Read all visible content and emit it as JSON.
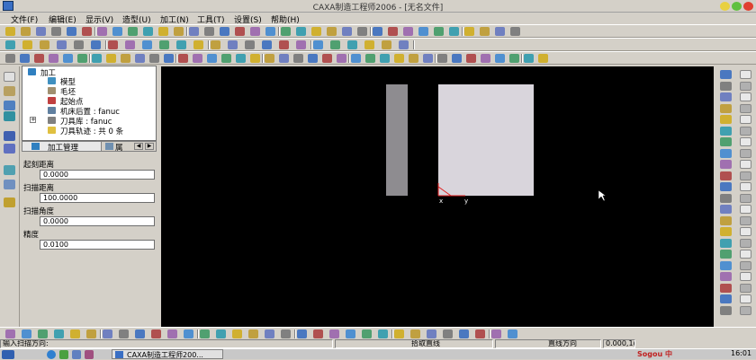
{
  "window": {
    "title": "CAXA制造工程师2006 - [无名文件]"
  },
  "menu": [
    "文件(F)",
    "编辑(E)",
    "显示(V)",
    "造型(U)",
    "加工(N)",
    "工具(T)",
    "设置(S)",
    "帮助(H)"
  ],
  "tree": {
    "root": "加工",
    "items": [
      "模型",
      "毛坯",
      "起始点",
      "机床后置 : fanuc",
      "刀具库 : fanuc",
      "刀具轨迹 : 共 0 条"
    ]
  },
  "panel_tabs": {
    "active": "加工管理",
    "second": "属"
  },
  "params": [
    {
      "label": "起刻距离",
      "value": "0.0000"
    },
    {
      "label": "扫描距离",
      "value": "100.0000"
    },
    {
      "label": "扫描角度",
      "value": "0.0000"
    },
    {
      "label": "精度",
      "value": "0.0100"
    }
  ],
  "canvas": {
    "axis_x": "x",
    "axis_y": "y"
  },
  "status": {
    "prompt": "输入扫描方向:",
    "command": "拾取直线",
    "mode": "直线方向",
    "coords": "0.000,1("
  },
  "taskbar": {
    "task": "CAXA制造工程师200...",
    "clock": "16:01",
    "ime": "Sogou 中"
  },
  "colors": {
    "canvas_bg": "#000000",
    "blank_fill": "#d9d5dc",
    "side_bar_fill": "#8e8c90",
    "axis_red": "#e02020"
  }
}
